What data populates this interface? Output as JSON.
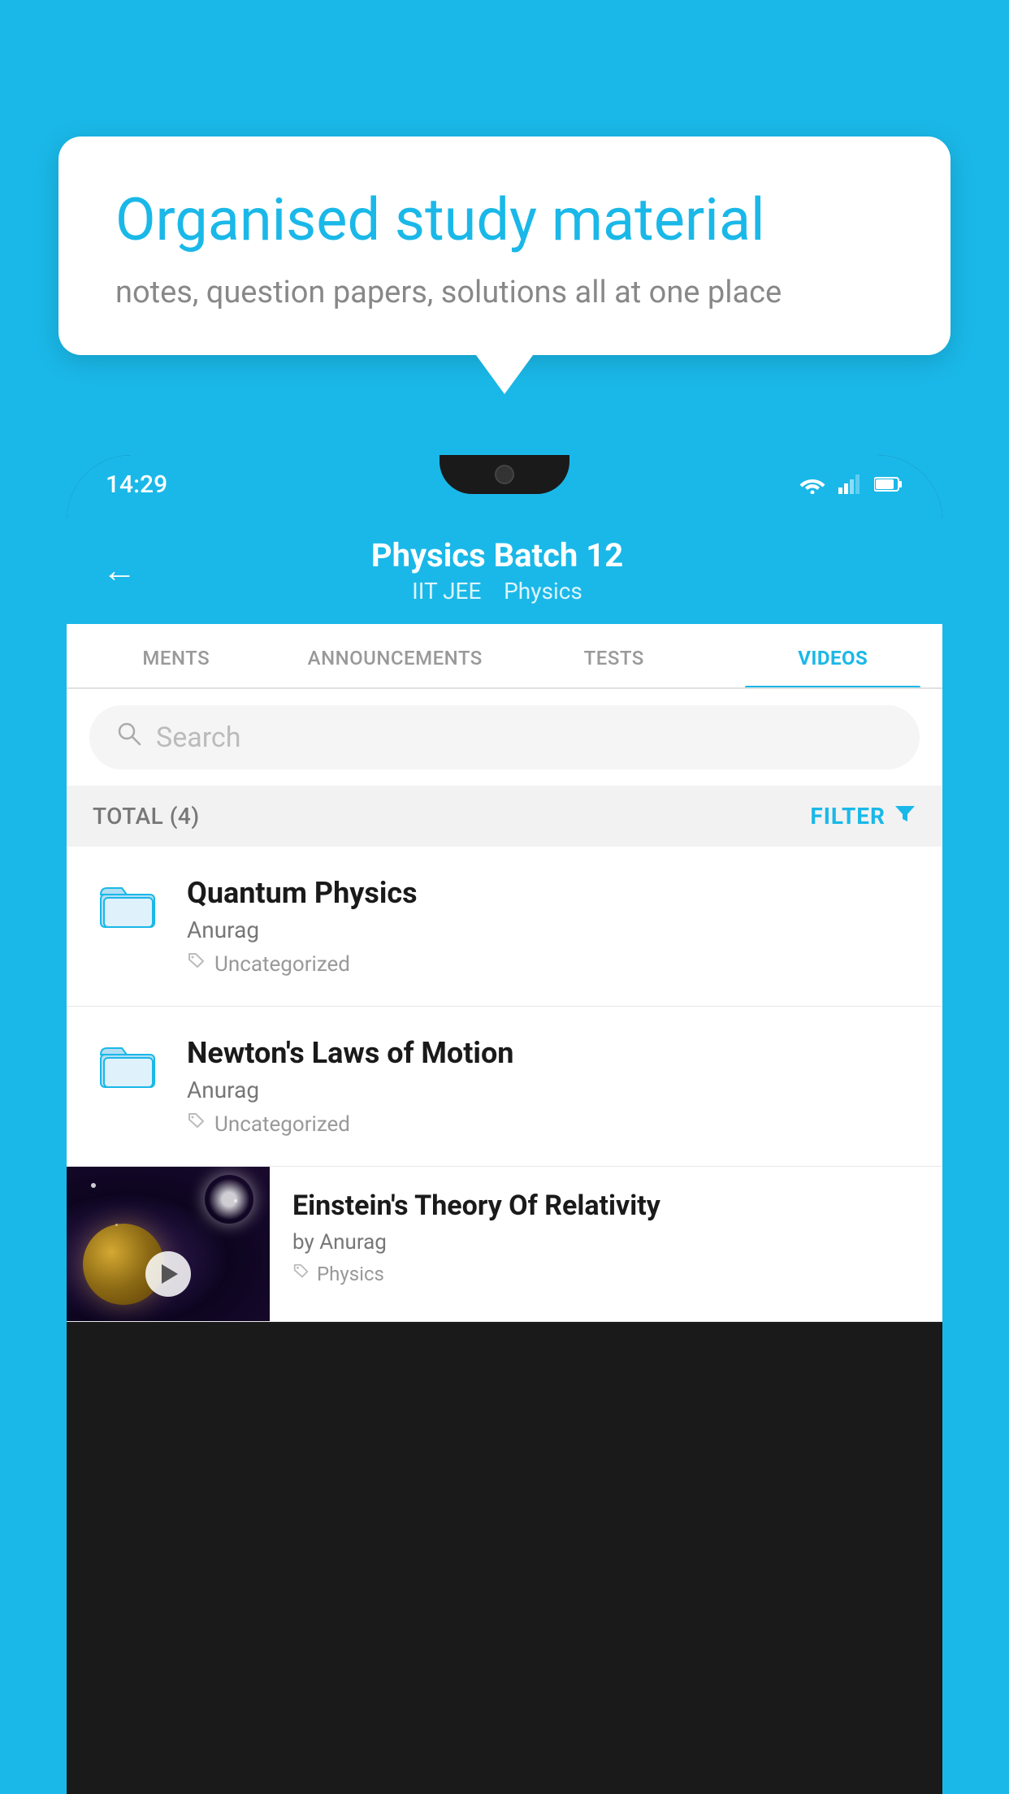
{
  "background_color": "#1ab8e8",
  "speech_bubble": {
    "title": "Organised study material",
    "subtitle": "notes, question papers, solutions all at one place"
  },
  "phone": {
    "status_bar": {
      "time": "14:29"
    },
    "app_header": {
      "title": "Physics Batch 12",
      "subtitle_part1": "IIT JEE",
      "subtitle_part2": "Physics",
      "back_label": "←"
    },
    "tabs": [
      {
        "label": "MENTS",
        "active": false
      },
      {
        "label": "ANNOUNCEMENTS",
        "active": false
      },
      {
        "label": "TESTS",
        "active": false
      },
      {
        "label": "VIDEOS",
        "active": true
      }
    ],
    "search": {
      "placeholder": "Search"
    },
    "filter_row": {
      "total_label": "TOTAL (4)",
      "filter_label": "FILTER"
    },
    "items": [
      {
        "type": "folder",
        "title": "Quantum Physics",
        "author": "Anurag",
        "tag": "Uncategorized"
      },
      {
        "type": "folder",
        "title": "Newton's Laws of Motion",
        "author": "Anurag",
        "tag": "Uncategorized"
      },
      {
        "type": "thumbnail",
        "title": "Einstein's Theory Of Relativity",
        "author": "by Anurag",
        "tag": "Physics"
      }
    ]
  }
}
